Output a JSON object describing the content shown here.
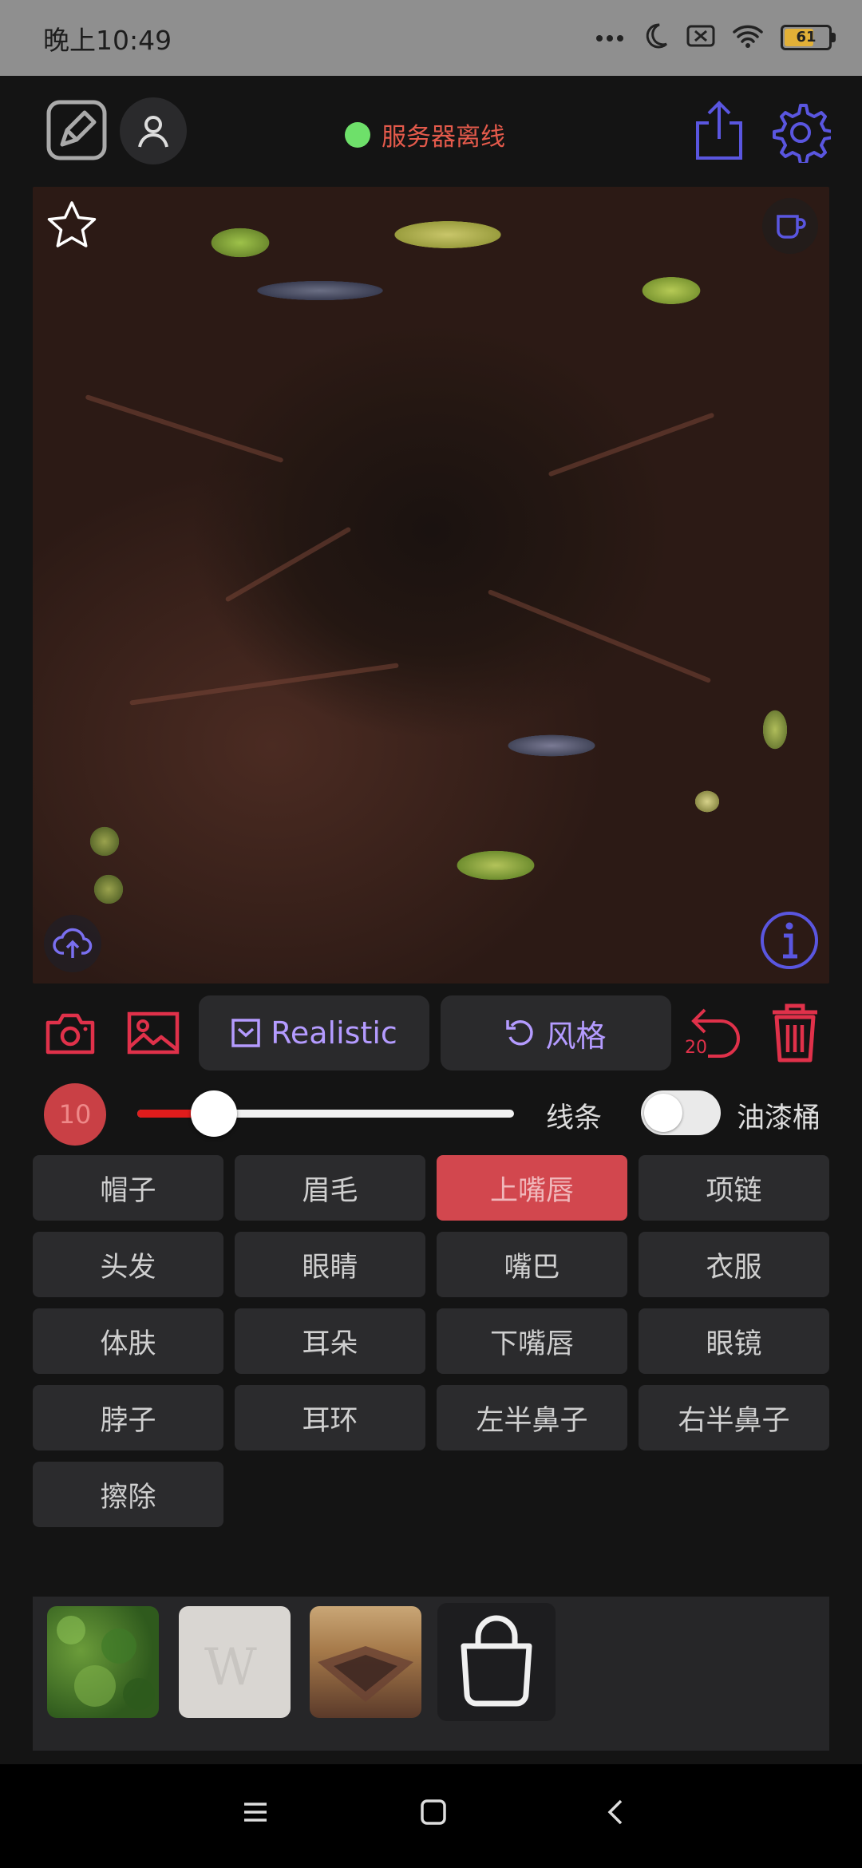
{
  "status_bar": {
    "time": "晚上10:49",
    "battery": "61",
    "icons": [
      "more-dots-icon",
      "moon-icon",
      "sim-off-icon",
      "wifi-icon",
      "battery-icon"
    ]
  },
  "header": {
    "server_status_text": "服务器离线",
    "server_status_color": "#6ee06a",
    "icons": [
      "draw-icon",
      "user-icon",
      "share-icon",
      "settings-icon"
    ]
  },
  "canvas": {
    "overlay_icons": [
      "star-icon",
      "coffee-icon",
      "cloud-upload-icon",
      "info-icon"
    ]
  },
  "toolbar": {
    "model_label": "Realistic",
    "style_label": "风格",
    "undo_count": "20",
    "icons": [
      "camera-icon",
      "image-icon",
      "checkbox-icon",
      "rotate-icon",
      "undo-icon",
      "trash-icon"
    ]
  },
  "brush": {
    "size": "10",
    "slider_value": 0.1,
    "line_label": "线条",
    "bucket_label": "油漆桶",
    "bucket_enabled": false
  },
  "parts": [
    {
      "label": "帽子",
      "active": false
    },
    {
      "label": "眉毛",
      "active": false
    },
    {
      "label": "上嘴唇",
      "active": true
    },
    {
      "label": "项链",
      "active": false
    },
    {
      "label": "头发",
      "active": false
    },
    {
      "label": "眼睛",
      "active": false
    },
    {
      "label": "嘴巴",
      "active": false
    },
    {
      "label": "衣服",
      "active": false
    },
    {
      "label": "体肤",
      "active": false
    },
    {
      "label": "耳朵",
      "active": false
    },
    {
      "label": "下嘴唇",
      "active": false
    },
    {
      "label": "眼镜",
      "active": false
    },
    {
      "label": "脖子",
      "active": false
    },
    {
      "label": "耳环",
      "active": false
    },
    {
      "label": "左半鼻子",
      "active": false
    },
    {
      "label": "右半鼻子",
      "active": false
    },
    {
      "label": "擦除",
      "active": false
    }
  ],
  "gallery": {
    "thumbnails": [
      "thumbnail-foliage",
      "thumbnail-blank",
      "thumbnail-cake"
    ],
    "bag_icon": "shopping-bag-icon"
  },
  "nav": [
    "menu-icon",
    "home-icon",
    "back-icon"
  ],
  "colors": {
    "accent_purple": "#b49bff",
    "accent_red": "#e0314a",
    "active_part": "#d2474e",
    "server_offline_text": "#e45a4b"
  }
}
